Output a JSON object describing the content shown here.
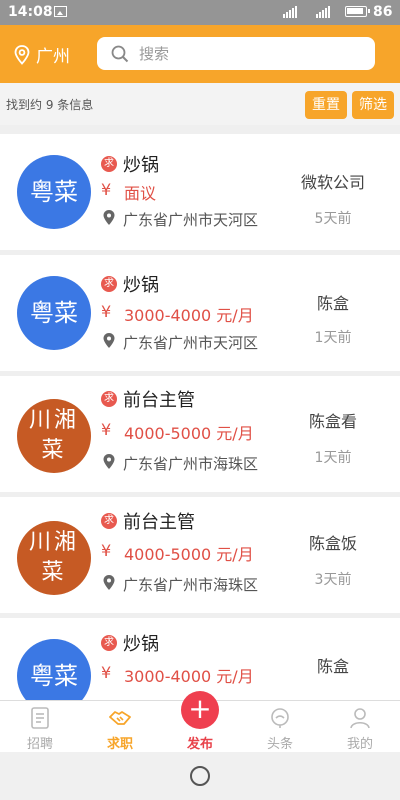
{
  "status_bar": {
    "time": "14:08",
    "battery": "86"
  },
  "header": {
    "city": "广州",
    "search_placeholder": "搜索"
  },
  "filter": {
    "result_count": "找到约 9 条信息",
    "reset_label": "重置",
    "filter_label": "筛选"
  },
  "jobs": [
    {
      "tag": "求",
      "avatar": "粤菜",
      "avatar_color": "#3b78e4",
      "title": "炒锅",
      "salary": "面议",
      "location": "广东省广州市天河区",
      "company": "微软公司",
      "time": "5天前"
    },
    {
      "tag": "求",
      "avatar": "粤菜",
      "avatar_color": "#3b78e4",
      "title": "炒锅",
      "salary": "3000-4000 元/月",
      "location": "广东省广州市天河区",
      "company": "陈盒",
      "time": "1天前"
    },
    {
      "tag": "求",
      "avatar": "川湘菜",
      "avatar_color": "#c65a24",
      "title": "前台主管",
      "salary": "4000-5000 元/月",
      "location": "广东省广州市海珠区",
      "company": "陈盒看",
      "time": "1天前"
    },
    {
      "tag": "求",
      "avatar": "川湘菜",
      "avatar_color": "#c65a24",
      "title": "前台主管",
      "salary": "4000-5000 元/月",
      "location": "广东省广州市海珠区",
      "company": "陈盒饭",
      "time": "3天前"
    },
    {
      "tag": "求",
      "avatar": "粤菜",
      "avatar_color": "#3b78e4",
      "title": "炒锅",
      "salary": "3000-4000 元/月",
      "location": "",
      "company": "陈盒",
      "time": ""
    }
  ],
  "currency_symbol": "¥",
  "tabs": [
    {
      "label": "招聘",
      "icon": "resume-icon"
    },
    {
      "label": "求职",
      "icon": "handshake-icon",
      "active": true
    },
    {
      "label": "发布",
      "icon": "plus-icon"
    },
    {
      "label": "头条",
      "icon": "news-icon"
    },
    {
      "label": "我的",
      "icon": "user-icon"
    }
  ],
  "colors": {
    "accent": "#f7a52a",
    "salary_red": "#e05046",
    "publish_red": "#ef3f4f"
  }
}
